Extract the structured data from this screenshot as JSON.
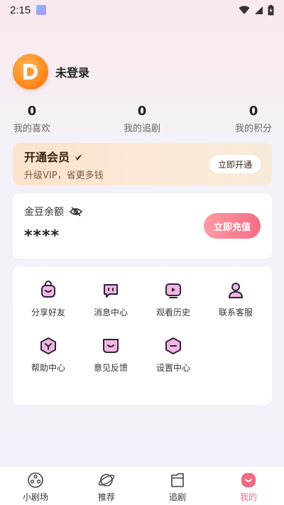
{
  "status_bar": {
    "time": "2:15"
  },
  "profile": {
    "login_text": "未登录"
  },
  "stats": [
    {
      "value": "0",
      "label": "我的喜欢"
    },
    {
      "value": "0",
      "label": "我的追剧"
    },
    {
      "value": "0",
      "label": "我的积分"
    }
  ],
  "vip": {
    "title": "开通会员",
    "subtitle": "升级VIP，省更多钱",
    "button": "立即开通"
  },
  "coins": {
    "label": "金豆余额",
    "value": "****",
    "button": "立即充值"
  },
  "menu": [
    {
      "label": "分享好友",
      "icon": "share-icon"
    },
    {
      "label": "消息中心",
      "icon": "message-icon"
    },
    {
      "label": "观看历史",
      "icon": "history-icon"
    },
    {
      "label": "联系客服",
      "icon": "service-icon"
    },
    {
      "label": "帮助中心",
      "icon": "help-icon"
    },
    {
      "label": "意见反馈",
      "icon": "feedback-icon"
    },
    {
      "label": "设置中心",
      "icon": "settings-icon"
    }
  ],
  "tabs": [
    {
      "label": "小剧场",
      "icon": "film-reel-icon",
      "active": false
    },
    {
      "label": "推荐",
      "icon": "planet-icon",
      "active": false
    },
    {
      "label": "追剧",
      "icon": "folder-icon",
      "active": false
    },
    {
      "label": "我的",
      "icon": "profile-icon",
      "active": true
    }
  ],
  "colors": {
    "accent": "#f06a82",
    "vip_bg": "#fbe3cc",
    "icon_stroke": "#2d2340",
    "icon_fill": "#f3b6de"
  }
}
